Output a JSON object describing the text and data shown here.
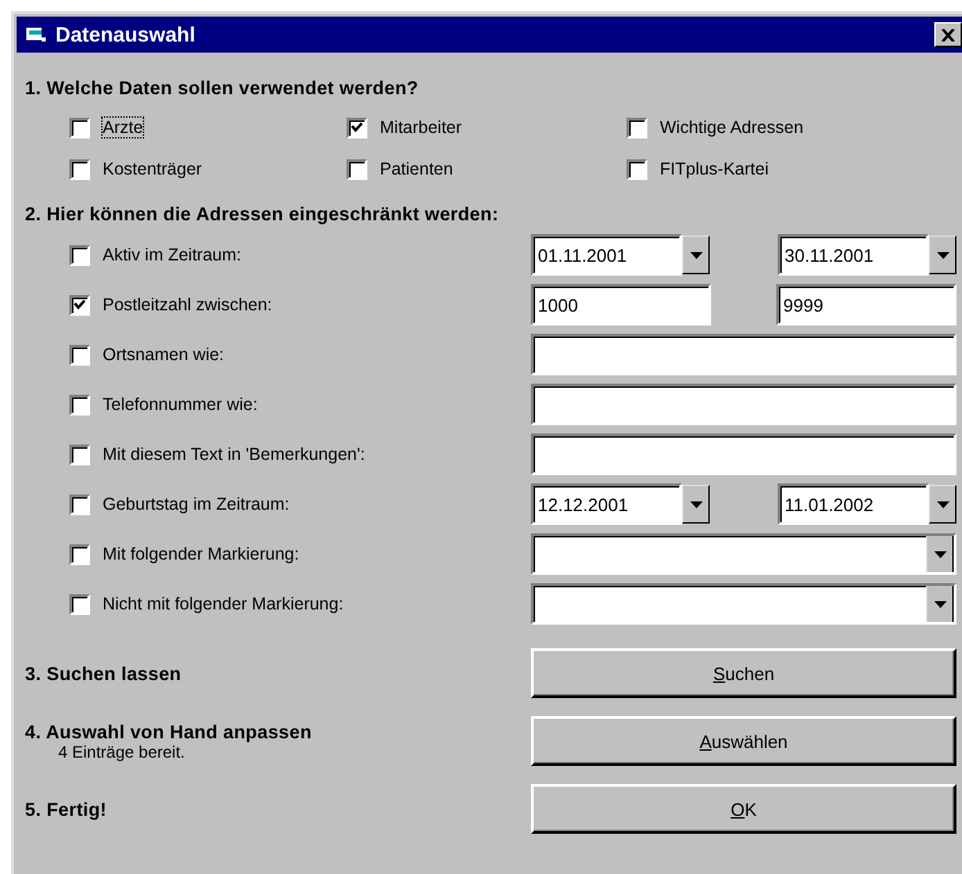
{
  "window": {
    "title": "Datenauswahl"
  },
  "data_section": {
    "heading": "1. Welche Daten sollen verwendet werden?",
    "options": [
      {
        "label": "Arzte",
        "checked": false,
        "focused": true
      },
      {
        "label": "Mitarbeiter",
        "checked": true,
        "focused": false
      },
      {
        "label": "Wichtige Adressen",
        "checked": false,
        "focused": false
      },
      {
        "label": "Kostenträger",
        "checked": false,
        "focused": false
      },
      {
        "label": "Patienten",
        "checked": false,
        "focused": false
      },
      {
        "label": "FITplus-Kartei",
        "checked": false,
        "focused": false
      }
    ]
  },
  "filter_section": {
    "heading": "2. Hier können die Adressen eingeschränkt werden:",
    "filters": [
      {
        "kind": "date_range",
        "label": "Aktiv im Zeitraum:",
        "checked": false,
        "from": "01.11.2001",
        "to": "30.11.2001"
      },
      {
        "kind": "text_range",
        "label": "Postleitzahl zwischen:",
        "checked": true,
        "from": "1000",
        "to": "9999"
      },
      {
        "kind": "text",
        "label": "Ortsnamen wie:",
        "checked": false
      },
      {
        "kind": "text",
        "label": "Telefonnummer wie:",
        "checked": false
      },
      {
        "kind": "text",
        "label": "Mit diesem Text in 'Bemerkungen':",
        "checked": false
      },
      {
        "kind": "date_range",
        "label": "Geburtstag im Zeitraum:",
        "checked": false,
        "from": "12.12.2001",
        "to": "11.01.2002"
      },
      {
        "kind": "dropdown",
        "label": "Mit folgender Markierung:",
        "checked": false
      },
      {
        "kind": "dropdown",
        "label": "Nicht mit folgender Markierung:",
        "checked": false
      }
    ]
  },
  "steps": [
    {
      "heading": "3. Suchen lassen",
      "button": "Suchen"
    },
    {
      "heading": "4. Auswahl von Hand anpassen",
      "note": "4 Einträge bereit.",
      "button": "Auswählen"
    },
    {
      "heading": "5. Fertig!",
      "button": "OK"
    }
  ]
}
